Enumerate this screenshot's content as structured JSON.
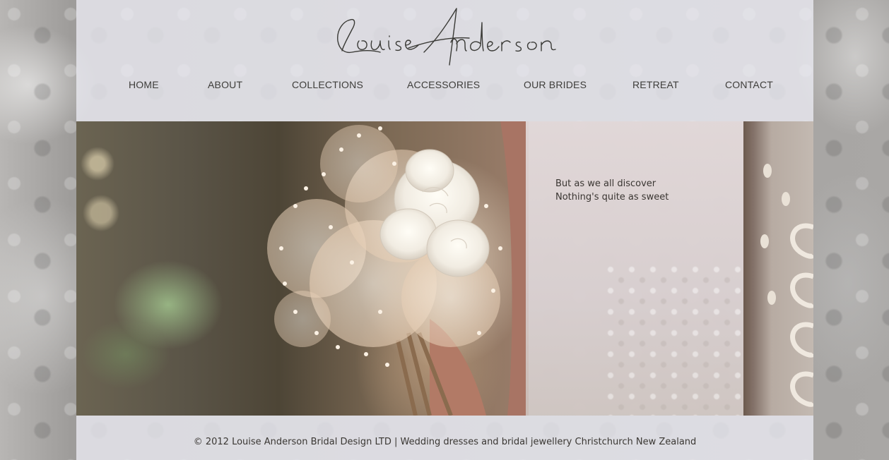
{
  "site": {
    "logo_text": "Louise Anderson"
  },
  "nav": {
    "items": [
      {
        "label": "HOME"
      },
      {
        "label": "ABOUT"
      },
      {
        "label": "COLLECTIONS"
      },
      {
        "label": "ACCESSORIES"
      },
      {
        "label": "OUR BRIDES"
      },
      {
        "label": "RETREAT"
      },
      {
        "label": "CONTACT"
      }
    ]
  },
  "hero": {
    "quote_line1": "But as we all discover",
    "quote_line2": "Nothing's quite as sweet"
  },
  "footer": {
    "text": "© 2012 Louise Anderson Bridal Design LTD | Wedding dresses and bridal jewellery Christchurch New Zealand"
  },
  "colors": {
    "nav_text": "#3e3d3a",
    "panel_overlay": "#ececf4"
  }
}
